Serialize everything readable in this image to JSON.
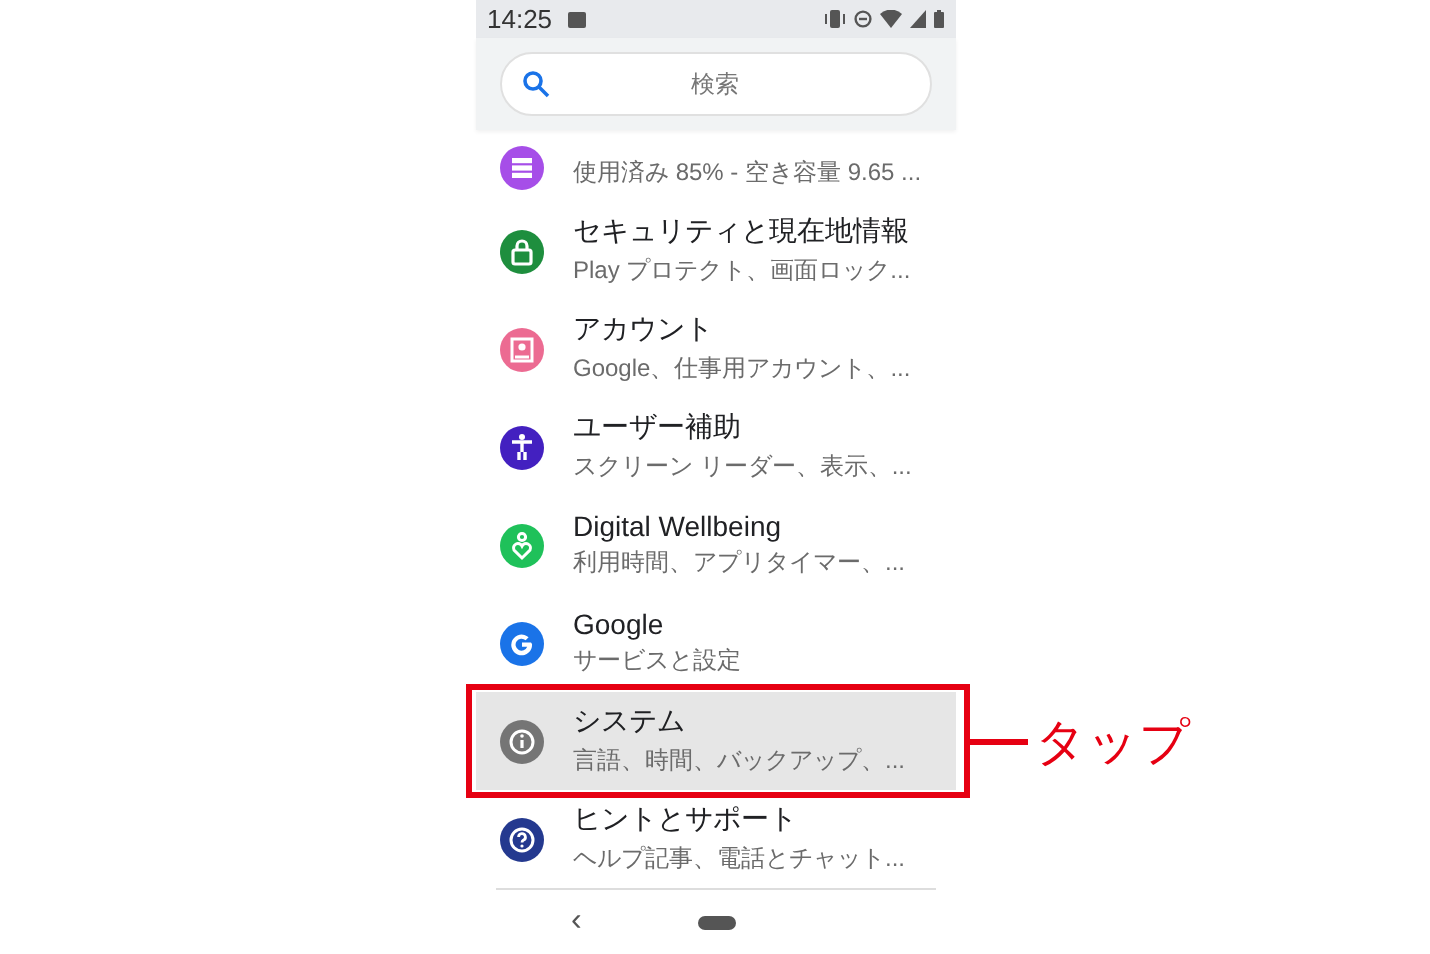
{
  "status_bar": {
    "time": "14:25"
  },
  "search": {
    "placeholder": "検索"
  },
  "settings": [
    {
      "kind": "storage",
      "subtitle": "使用済み 85% - 空き容量 9.65 ...",
      "color": "#a64ee8",
      "selected": false
    },
    {
      "kind": "security",
      "title": "セキュリティと現在地情報",
      "subtitle": "Play プロテクト、画面ロック...",
      "color": "#1e8e3e",
      "selected": false
    },
    {
      "kind": "account",
      "title": "アカウント",
      "subtitle": "Google、仕事用アカウント、...",
      "color": "#ec6b92",
      "selected": false
    },
    {
      "kind": "accessibility",
      "title": "ユーザー補助",
      "subtitle": "スクリーン リーダー、表示、...",
      "color": "#4320c0",
      "selected": false
    },
    {
      "kind": "wellbeing",
      "title": "Digital Wellbeing",
      "subtitle": "利用時間、アプリタイマー、...",
      "color": "#1fc15a",
      "selected": false
    },
    {
      "kind": "google",
      "title": "Google",
      "subtitle": "サービスと設定",
      "color": "#1a73e8",
      "selected": false
    },
    {
      "kind": "system",
      "title": "システム",
      "subtitle": "言語、時間、バックアップ、...",
      "color": "#757575",
      "selected": true,
      "callout": "タップ"
    },
    {
      "kind": "help",
      "title": "ヒントとサポート",
      "subtitle": "ヘルプ記事、電話とチャット...",
      "color": "#24398f",
      "selected": false
    }
  ],
  "nav_bar": {
    "back": "‹"
  }
}
